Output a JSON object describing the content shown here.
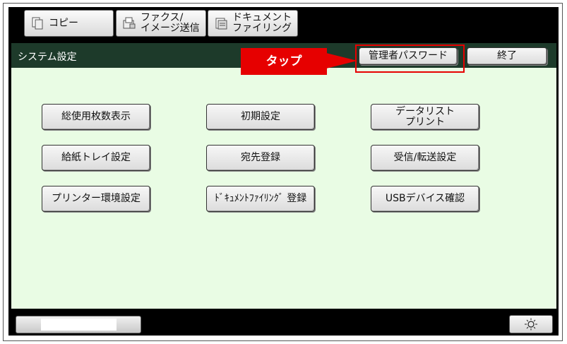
{
  "tabs": [
    {
      "label": "コピー",
      "icon": "copy-icon"
    },
    {
      "label": "ファクス/\nイメージ送信",
      "icon": "fax-image-icon"
    },
    {
      "label": "ドキュメント\nファイリング",
      "icon": "document-filing-icon"
    }
  ],
  "header": {
    "title": "システム設定",
    "admin_password_label": "管理者パスワード",
    "exit_label": "終了"
  },
  "callout": {
    "label": "タップ",
    "color": "#e60000"
  },
  "menu": {
    "total_count": "総使用枚数表示",
    "initial_settings": "初期設定",
    "data_list_print": "データリスト\nプリント",
    "paper_tray_settings": "給紙トレイ設定",
    "address_registration": "宛先登録",
    "receive_forward_settings": "受信/転送設定",
    "printer_env_settings": "プリンター環境設定",
    "document_filing_registration": "ﾄﾞｷｭﾒﾝﾄﾌｧｲﾘﾝｸﾞ 登録",
    "usb_device_check": "USBデバイス確認"
  },
  "footer": {
    "status_level": 0.61,
    "brightness_icon": "sun-icon"
  },
  "colors": {
    "screen_bg": "#e9fce4",
    "titlebar_bg": "#1d3a2a",
    "highlight": "#e60000"
  }
}
